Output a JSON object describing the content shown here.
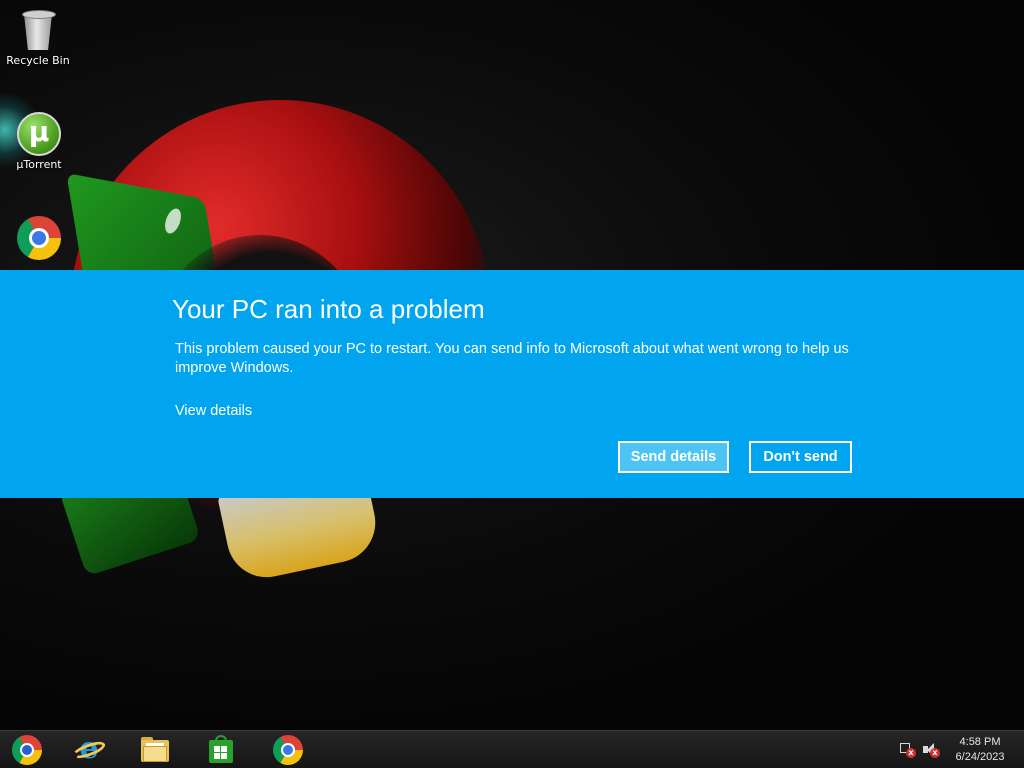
{
  "desktop": {
    "icons": [
      {
        "label": "Recycle Bin",
        "icon": "recycle-bin-icon"
      },
      {
        "label": "µTorrent",
        "icon": "utorrent-icon"
      },
      {
        "label": "",
        "icon": "chrome-icon"
      }
    ]
  },
  "error_dialog": {
    "title": "Your PC ran into a problem",
    "message": "This problem caused your PC to restart. You can send info to Microsoft about what went wrong to help us improve Windows.",
    "view_details_link": "View details",
    "send_button": "Send details",
    "dont_send_button": "Don't send",
    "background_color": "#00a4ef",
    "primary_button_color": "#4ec4f5"
  },
  "taskbar": {
    "pinned": [
      {
        "name": "media-player-icon"
      },
      {
        "name": "internet-explorer-icon"
      },
      {
        "name": "file-explorer-icon"
      },
      {
        "name": "windows-store-icon"
      },
      {
        "name": "chrome-icon"
      }
    ],
    "tray": {
      "network_status": "disconnected",
      "volume_status": "muted"
    },
    "clock": {
      "time": "4:58 PM",
      "date": "6/24/2023"
    }
  }
}
